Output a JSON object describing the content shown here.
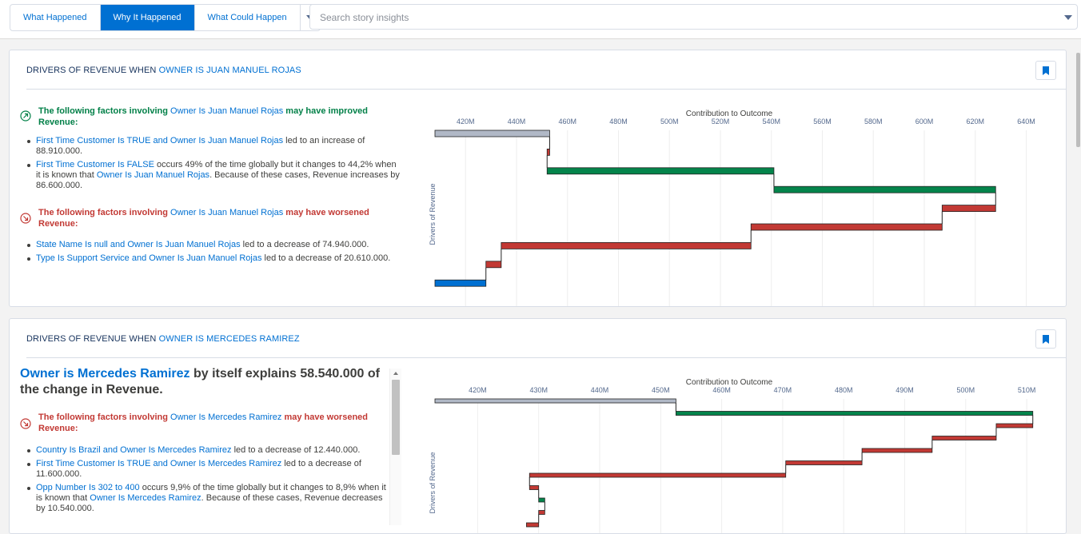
{
  "tabs": [
    {
      "label": "What Happened",
      "active": false
    },
    {
      "label": "Why It Happened",
      "active": true
    },
    {
      "label": "What Could Happen",
      "active": false
    }
  ],
  "search": {
    "placeholder": "Search story insights",
    "value": ""
  },
  "icons": {
    "tab_more": "chevron-down-icon",
    "search_dropdown": "chevron-down-icon",
    "bookmark": "bookmark-icon",
    "improved": "trend-up-icon",
    "worsened": "trend-down-icon"
  },
  "colors": {
    "accent": "#0070d2",
    "improved": "#028048",
    "worsened": "#c23934",
    "bar_green": "#04844b",
    "bar_red": "#c23934",
    "bar_blue": "#0070d2",
    "bar_gray": "#b0b8c6"
  },
  "cards": [
    {
      "title_prefix": "DRIVERS OF REVENUE WHEN ",
      "title_highlight": "OWNER IS JUAN MANUEL ROJAS",
      "improved": {
        "pre": "The following factors involving ",
        "link": "Owner Is Juan Manuel Rojas",
        "post": " may have improved Revenue:",
        "items": [
          {
            "link": "First Time Customer Is TRUE and Owner Is Juan Manuel Rojas",
            "text": " led to an increase of 88.910.000."
          },
          {
            "link": "First Time Customer Is FALSE",
            "text": " occurs 49% of the time globally but it changes to 44,2% when it is known that ",
            "link2": "Owner Is Juan Manuel Rojas",
            "text2": ". Because of these cases, Revenue increases by 86.600.000."
          }
        ]
      },
      "worsened": {
        "pre": "The following factors involving ",
        "link": "Owner Is Juan Manuel Rojas",
        "post": " may have worsened Revenue:",
        "items": [
          {
            "link": "State Name Is null and Owner Is Juan Manuel Rojas",
            "text": " led to a decrease of 74.940.000."
          },
          {
            "link": "Type Is Support Service and Owner Is Juan Manuel Rojas",
            "text": " led to a decrease of 20.610.000."
          }
        ]
      }
    },
    {
      "title_prefix": "DRIVERS OF REVENUE WHEN ",
      "title_highlight": "OWNER IS MERCEDES RAMIREZ",
      "headline": {
        "link": "Owner is Mercedes Ramirez",
        "text": " by itself explains 58.540.000 of the change in Revenue."
      },
      "worsened": {
        "pre": "The following factors involving ",
        "link": "Owner Is Mercedes Ramirez",
        "post": " may have worsened Revenue:",
        "items": [
          {
            "link": "Country Is Brazil and Owner Is Mercedes Ramirez",
            "text": " led to a decrease of 12.440.000."
          },
          {
            "link": "First Time Customer Is TRUE and Owner Is Mercedes Ramirez",
            "text": " led to a decrease of 11.600.000."
          },
          {
            "link": "Opp Number Is 302 to 400",
            "text": " occurs 9,9% of the time globally but it changes to 8,9% when it is known that ",
            "link2": "Owner Is Mercedes Ramirez",
            "text2": ". Because of these cases, Revenue decreases by 10.540.000."
          }
        ]
      }
    }
  ],
  "chart_data": [
    {
      "type": "waterfall",
      "title": "Contribution to Outcome",
      "ylabel": "Drivers of Revenue",
      "xlim": [
        408,
        648
      ],
      "ticks": [
        420,
        440,
        460,
        480,
        500,
        520,
        540,
        560,
        580,
        600,
        620,
        640
      ],
      "tick_labels": [
        "420M",
        "440M",
        "460M",
        "480M",
        "500M",
        "520M",
        "540M",
        "560M",
        "580M",
        "600M",
        "620M",
        "640M"
      ],
      "steps": [
        {
          "start": 408,
          "end": 453,
          "kind": "gray"
        },
        {
          "start": 453,
          "end": 452,
          "kind": "red"
        },
        {
          "start": 452,
          "end": 541,
          "kind": "green"
        },
        {
          "start": 541,
          "end": 628,
          "kind": "green"
        },
        {
          "start": 628,
          "end": 607,
          "kind": "red"
        },
        {
          "start": 607,
          "end": 532,
          "kind": "red"
        },
        {
          "start": 532,
          "end": 434,
          "kind": "red"
        },
        {
          "start": 434,
          "end": 428,
          "kind": "red"
        },
        {
          "start": 428,
          "end": 408,
          "kind": "blue"
        }
      ]
    },
    {
      "type": "waterfall",
      "title": "Contribution to Outcome",
      "ylabel": "Drivers of Revenue",
      "xlim": [
        413,
        513
      ],
      "ticks": [
        420,
        430,
        440,
        450,
        460,
        470,
        480,
        490,
        500,
        510
      ],
      "tick_labels": [
        "420M",
        "430M",
        "440M",
        "450M",
        "460M",
        "470M",
        "480M",
        "490M",
        "500M",
        "510M"
      ],
      "steps": [
        {
          "start": 413,
          "end": 452.5,
          "kind": "gray"
        },
        {
          "start": 452.5,
          "end": 511,
          "kind": "green"
        },
        {
          "start": 511,
          "end": 505,
          "kind": "red"
        },
        {
          "start": 505,
          "end": 494.5,
          "kind": "red"
        },
        {
          "start": 494.5,
          "end": 483,
          "kind": "red"
        },
        {
          "start": 483,
          "end": 470.5,
          "kind": "red"
        },
        {
          "start": 470.5,
          "end": 428.5,
          "kind": "red"
        },
        {
          "start": 428.5,
          "end": 430,
          "kind": "red"
        },
        {
          "start": 430,
          "end": 431,
          "kind": "green"
        },
        {
          "start": 431,
          "end": 430,
          "kind": "red"
        },
        {
          "start": 430,
          "end": 428,
          "kind": "red"
        }
      ]
    }
  ]
}
